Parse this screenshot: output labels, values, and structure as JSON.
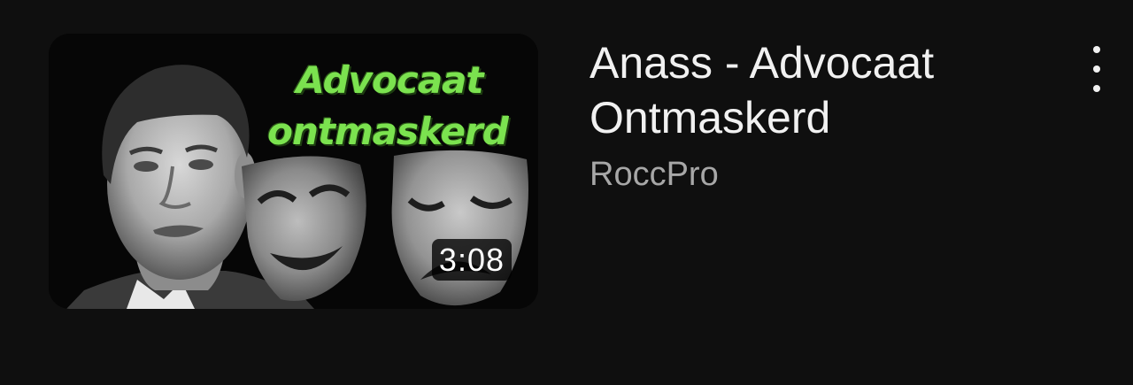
{
  "video": {
    "title": "Anass - Advocaat Ontmaskerd",
    "channel": "RoccPro",
    "duration": "3:08",
    "thumbnail": {
      "text_line1": "Advocaat",
      "text_line2": "ontmaskerd",
      "text_color": "#7be24f"
    }
  },
  "actions": {
    "more_icon": "more-vertical-icon"
  },
  "colors": {
    "background": "#0f0f0f",
    "title": "#f1f1f1",
    "channel": "#a7a7a7"
  }
}
